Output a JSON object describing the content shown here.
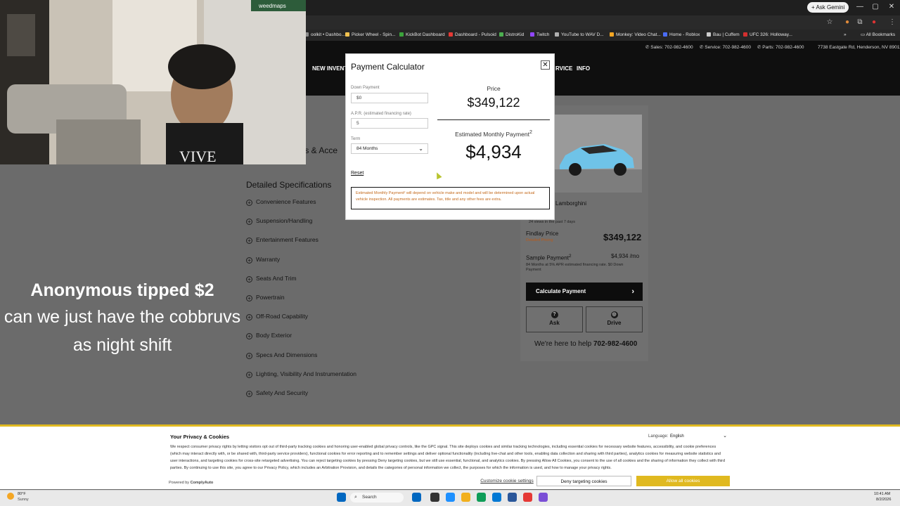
{
  "browser": {
    "ask_gemini": "Ask Gemini",
    "window_controls": [
      "—",
      "▢",
      "✕"
    ],
    "bookmarks": [
      "oolkit • Dashbo...",
      "Picker Wheel - Spin...",
      "KickBot Dashboard",
      "Dashboard - Pulsoid",
      "DistroKid",
      "Twitch",
      "YouTube to WAV D...",
      "Monkey: Video Chat...",
      "Home - Roblox",
      "Bau | Cuffem",
      "UFC 326: Holloway..."
    ],
    "bookmark_colors": [
      "#8a8a8a",
      "#f2c14e",
      "#3ba33b",
      "#e53935",
      "#4caf50",
      "#9146ff",
      "#b0b0b0",
      "#f5a623",
      "#4a6cf7",
      "#cccccc",
      "#d32f2f"
    ],
    "all_bookmarks": "All Bookmarks"
  },
  "site": {
    "contact": {
      "sales": "Sales: 702-982-4600",
      "service": "Service: 702-982-4600",
      "parts": "Parts: 702-982-4600",
      "address": "7738 Eastgate Rd, Henderson, NV 89011"
    },
    "nav": [
      "NEW INVENTO",
      "RVICE",
      "INFO"
    ],
    "section_heading_partial": "ges & Acce",
    "specs_heading": "Detailed Specifications",
    "specs": [
      "Convenience Features",
      "Suspension/Handling",
      "Entertainment Features",
      "Warranty",
      "Seats And Trim",
      "Powertrain",
      "Off-Road Capability",
      "Body Exterior",
      "Specs And Dimensions",
      "Lighting, Visibility And Instrumentation",
      "Safety And Security"
    ],
    "vehicle": {
      "name": "Lamborghini",
      "views": "24 views in the past 7 days",
      "findlay_label": "Findlay Price",
      "detailed_pricing": "Detailed Pricing",
      "findlay_price": "$349,122",
      "sample_label": "Sample Payment",
      "sample_sup": "2",
      "sample_value": "$4,934",
      "sample_unit": "/mo",
      "sample_terms": "84 Months at 5% APR estimated financing rate. $0 Down Payment",
      "calc_button": "Calculate Payment",
      "ask": "Ask",
      "drive": "Drive",
      "help_prefix": "We're here to help",
      "help_phone": "702-982-4600",
      "car_color": "#6fc3e8"
    }
  },
  "modal": {
    "title": "Payment Calculator",
    "close": "✕",
    "down_payment_label": "Down Payment",
    "down_payment_value": "$0",
    "apr_label": "A.P.R. (estimated financing rate)",
    "apr_value": "5",
    "term_label": "Term",
    "term_value": "84 Months",
    "reset": "Reset",
    "price_label": "Price",
    "price_value": "$349,122",
    "monthly_label": "Estimated Monthly Payment",
    "monthly_sup": "2",
    "monthly_value": "$4,934",
    "disclaimer": "Estimated Monthly Payment² will depend on vehicle make and model and will be determined upon actual vehicle inspection. All payments are estimates. Tax, title and any other fees are extra."
  },
  "overlay": {
    "tip_strong": "Anonymous tipped $2",
    "tip_message": "can we just have the cobbruvs as night shift",
    "cam_badge": "weedmaps"
  },
  "cookie": {
    "title": "Your Privacy & Cookies",
    "language_label": "Language:",
    "language_value": "English",
    "text": "We respect consumer privacy rights by letting visitors opt out of third-party tracking cookies and honoring user-enabled global privacy controls, like the GPC signal. This site deploys cookies and similar tracking technologies, including essential cookies for necessary website features, accessibility, and cookie preferences (which may interact directly with, or be shared with, third-party service providers), functional cookies for error reporting and to remember settings and deliver optional functionality (including live-chat and other tools, enabling data collection and sharing with third parties), analytics cookies for measuring website statistics and user interactions, and targeting cookies for cross-site retargeted advertising. You can reject targeting cookies by pressing Deny targeting cookies, but we still use essential, functional, and analytics cookies. By pressing Allow All Cookies, you consent to the use of all cookies and the sharing of information they collect with third parties. By continuing to use this site, you agree to our Privacy Policy, which includes an Arbitration Provision, and details the categories of personal information we collect, the purposes for which the information is used, and how to manage your privacy rights.",
    "powered_by": "Powered by",
    "powered_brand": "ComplyAuto",
    "customize": "Customize cookie settings",
    "deny": "Deny targeting cookies",
    "allow": "Allow all cookies"
  },
  "taskbar": {
    "weather_temp": "80°F",
    "weather_cond": "Sunny",
    "search_placeholder": "Search",
    "time": "10:41 AM",
    "date": "8/2/2026",
    "app_colors": [
      "#0067c0",
      "#333333",
      "#1e90ff",
      "#f2b01e",
      "#0f9d58",
      "#0078d4",
      "#2b579a",
      "#e53935",
      "#7b4fd6"
    ]
  }
}
